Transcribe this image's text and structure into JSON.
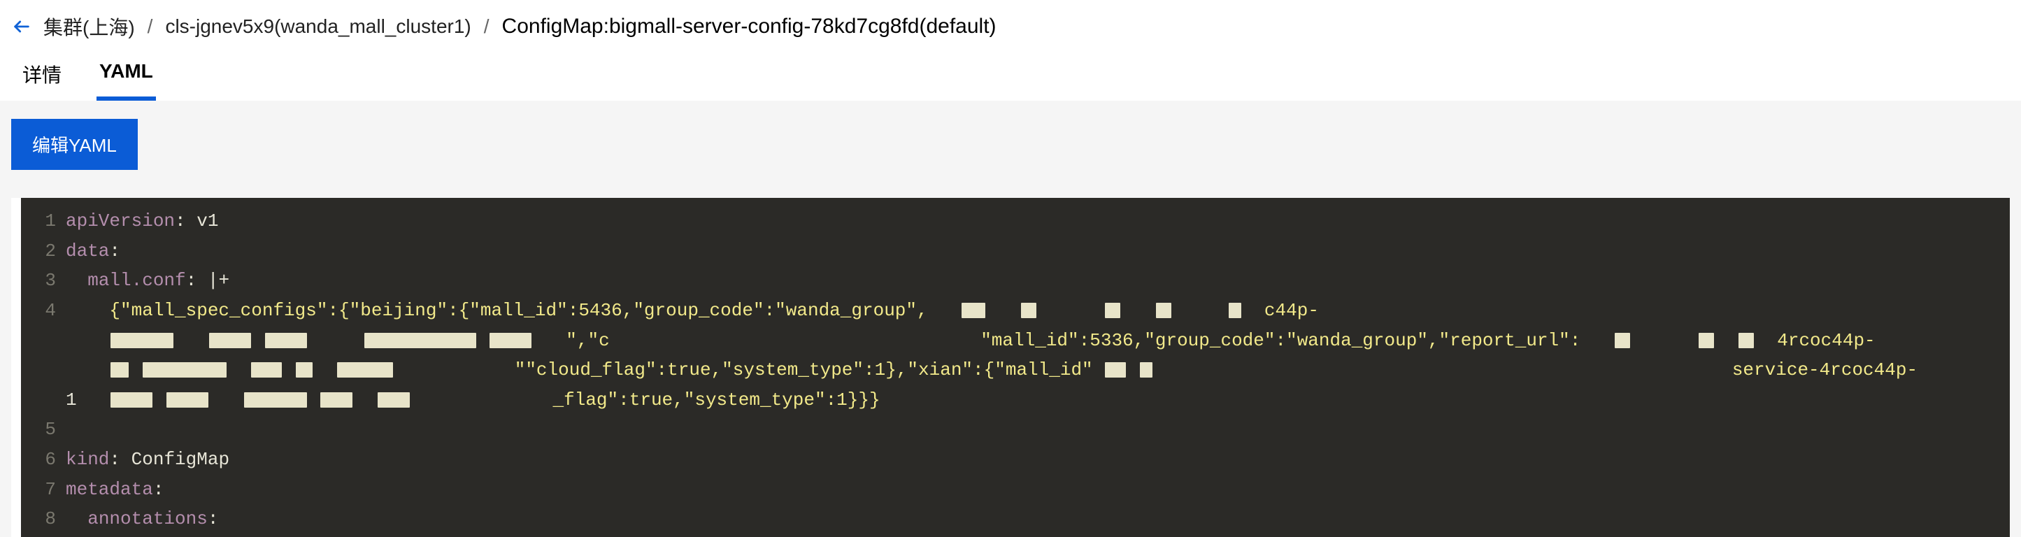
{
  "breadcrumb": {
    "back_icon": "arrow-left",
    "region": "集群(上海)",
    "cluster": "cls-jgnev5x9(wanda_mall_cluster1)",
    "current": "ConfigMap:bigmall-server-config-78kd7cg8fd(default)"
  },
  "tabs": {
    "detail": "详情",
    "yaml": "YAML",
    "active": "yaml"
  },
  "actions": {
    "edit_yaml": "编辑YAML"
  },
  "yaml": {
    "lines": [
      "apiVersion: v1",
      "data:",
      "  mall.conf: |+",
      "    {\"mall_spec_configs\":{\"beijing\":{\"mall_id\":5436,\"group_code\":\"wanda_group\",",
      "    ",
      "    ",
      "",
      "kind: ConfigMap",
      "metadata:",
      "  annotations:"
    ],
    "line4_prefix": "    {\"mall_spec_configs\":{\"beijing\":{\"mall_id\":5436,\"group_code\":\"wanda_group\",",
    "line4_tail_a": "c44p-",
    "cont1_mid": ":5336,\"group_code\":\"wanda_group\",\"report_url\":",
    "cont1_tail": "4rcoc44p-",
    "cont2_seg_a": "\",\"c",
    "cont2_seg_b": "\"cloud_flag\":true,\"system_type\":1},\"xian\":{\"mall_id\"",
    "cont2_mid_frag": "\"mall_id\"",
    "cont2_tail": "service-4rcoc44p-",
    "cont3_seg": "_flag\":true,\"system_type\":1}}}"
  }
}
